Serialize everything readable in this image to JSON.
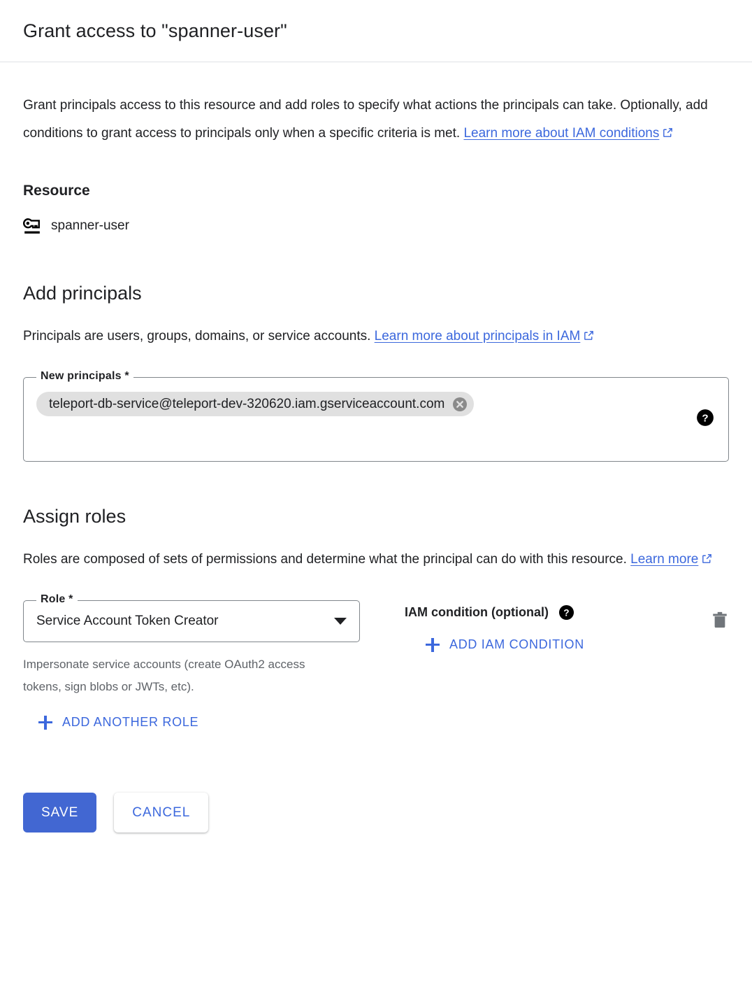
{
  "header": {
    "title": "Grant access to \"spanner-user\""
  },
  "intro": {
    "text_before_link": "Grant principals access to this resource and add roles to specify what actions the principals can take. Optionally, add conditions to grant access to principals only when a specific criteria is met. ",
    "link_label": "Learn more about IAM conditions"
  },
  "resource": {
    "heading": "Resource",
    "icon": "service-account-key-icon",
    "name": "spanner-user"
  },
  "add_principals": {
    "heading": "Add principals",
    "desc_before_link": "Principals are users, groups, domains, or service accounts. ",
    "link_label": "Learn more about principals in IAM",
    "field_label": "New principals *",
    "chips": [
      {
        "label": "teleport-db-service@teleport-dev-320620.iam.gserviceaccount.com",
        "remove_icon": "cancel-circle-icon"
      }
    ],
    "help_icon": "help-icon"
  },
  "assign_roles": {
    "heading": "Assign roles",
    "desc_before_link": "Roles are composed of sets of permissions and determine what the principal can do with this resource. ",
    "link_label": "Learn more",
    "role_field_label": "Role *",
    "role_value": "Service Account Token Creator",
    "role_help": "Impersonate service accounts (create OAuth2 access tokens, sign blobs or JWTs, etc).",
    "condition_label": "IAM condition (optional)",
    "condition_help_icon": "help-icon",
    "add_condition_label": "ADD IAM CONDITION",
    "delete_icon": "trash-icon",
    "add_another_role_label": "ADD ANOTHER ROLE"
  },
  "footer": {
    "save_label": "SAVE",
    "cancel_label": "CANCEL"
  },
  "colors": {
    "link_blue": "#3c68dd",
    "primary_blue": "#4267d2",
    "chip_gray": "#e0e0e0",
    "border_gray": "#80868b",
    "muted_text": "#5f6368"
  }
}
